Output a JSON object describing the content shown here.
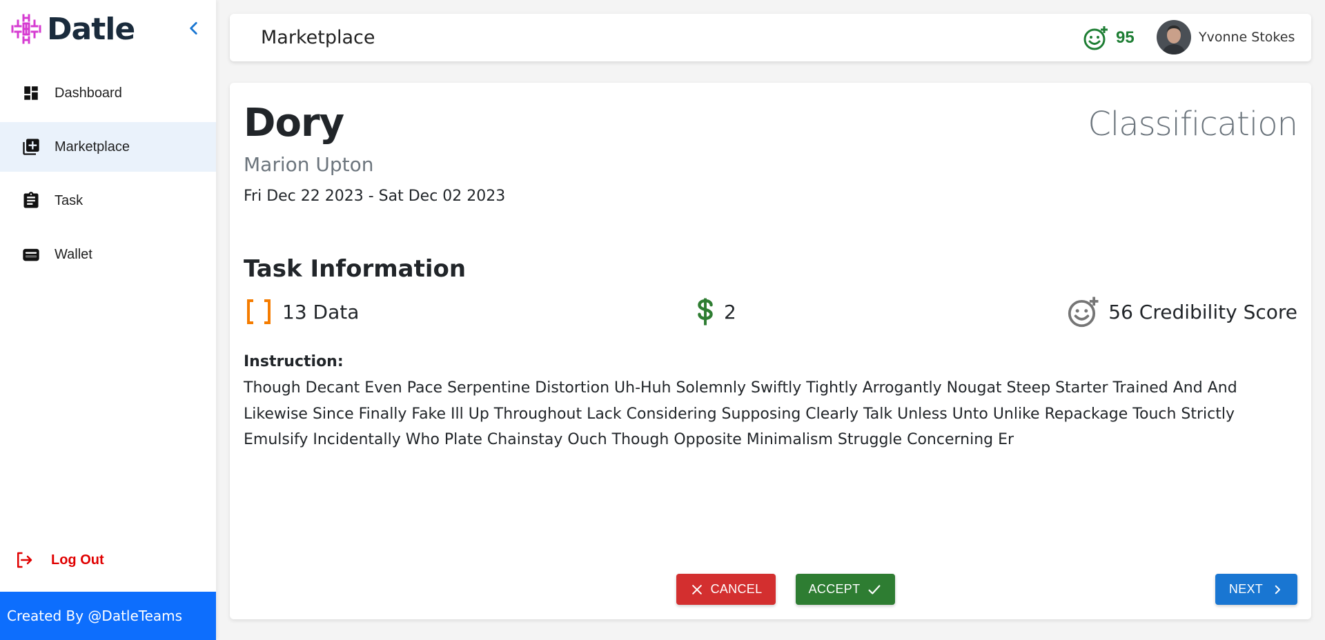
{
  "app": {
    "brand_name": "Datle",
    "footer_text": "Created By @DatleTeams"
  },
  "sidebar": {
    "items": [
      {
        "label": "Dashboard",
        "icon": "dashboard-icon",
        "active": false
      },
      {
        "label": "Marketplace",
        "icon": "add-box-icon",
        "active": true
      },
      {
        "label": "Task",
        "icon": "clipboard-icon",
        "active": false
      },
      {
        "label": "Wallet",
        "icon": "wallet-icon",
        "active": false
      }
    ],
    "logout_label": "Log Out"
  },
  "header": {
    "title": "Marketplace",
    "credibility_score": "95",
    "user_name": "Yvonne Stokes"
  },
  "task": {
    "name": "Dory",
    "type": "Classification",
    "requester": "Marion Upton",
    "date_range": "Fri Dec 22 2023 - Sat Dec 02 2023",
    "section_heading": "Task Information",
    "data_count_text": "13 Data",
    "reward_text": "2",
    "credibility_text": "56 Credibility Score",
    "instruction_label": "Instruction:",
    "instruction_text": "Though Decant Even Pace Serpentine Distortion Uh-Huh Solemnly Swiftly Tightly Arrogantly Nougat Steep Starter Trained And And Likewise Since Finally Fake Ill Up Throughout Lack Considering Supposing Clearly Talk Unless Unto Unlike Repackage Touch Strictly Emulsify Incidentally Who Plate Chainstay Ouch Though Opposite Minimalism Struggle Concerning Er"
  },
  "actions": {
    "cancel_label": "CANCEL",
    "accept_label": "ACCEPT",
    "next_label": "NEXT"
  },
  "colors": {
    "primary": "#1976d2",
    "danger": "#d32f2f",
    "success": "#2e7d32",
    "logo": "#d63bd1",
    "bracket": "#f57c00",
    "footer": "#0d6efd"
  }
}
